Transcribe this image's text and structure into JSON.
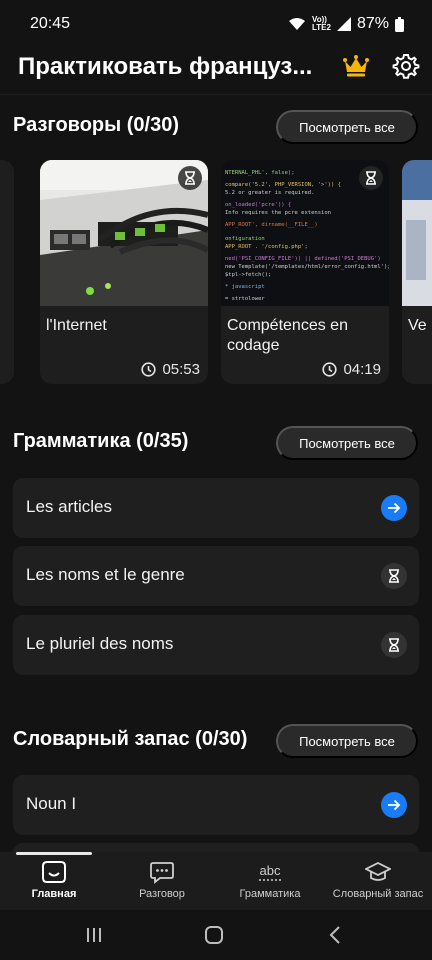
{
  "status": {
    "time": "20:45",
    "network": [
      "Vo))",
      "LTE2"
    ],
    "battery": "87%"
  },
  "header": {
    "title": "Практиковать француз...",
    "crown_icon": "crown-icon",
    "settings_icon": "gear-icon"
  },
  "conversations": {
    "title": "Разговоры (0/30)",
    "view_all": "Посмотреть все",
    "cards": [
      {
        "title": "l'Internet",
        "duration": "05:53",
        "locked": true
      },
      {
        "title": "Compétences en codage",
        "duration": "04:19",
        "locked": true
      },
      {
        "title": "Ve",
        "duration": "",
        "locked": false
      }
    ]
  },
  "grammar": {
    "title": "Грамматика (0/35)",
    "view_all": "Посмотреть все",
    "items": [
      {
        "label": "Les articles",
        "state": "open"
      },
      {
        "label": "Les noms et le genre",
        "state": "locked"
      },
      {
        "label": "Le pluriel des noms",
        "state": "locked"
      }
    ]
  },
  "vocabulary": {
    "title": "Словарный запас (0/30)",
    "view_all": "Посмотреть все",
    "items": [
      {
        "label": "Noun I",
        "state": "open"
      }
    ]
  },
  "bottom_nav": {
    "tabs": [
      {
        "label": "Главная",
        "icon": "home-icon",
        "active": true
      },
      {
        "label": "Разговор",
        "icon": "chat-icon",
        "active": false
      },
      {
        "label": "Грамматика",
        "icon": "abc-icon",
        "active": false
      },
      {
        "label": "Словарный запас",
        "icon": "graduation-cap-icon",
        "active": false
      }
    ]
  },
  "colors": {
    "accent": "#1a7cf5",
    "background": "#131313",
    "surface": "#1f1f1f"
  }
}
